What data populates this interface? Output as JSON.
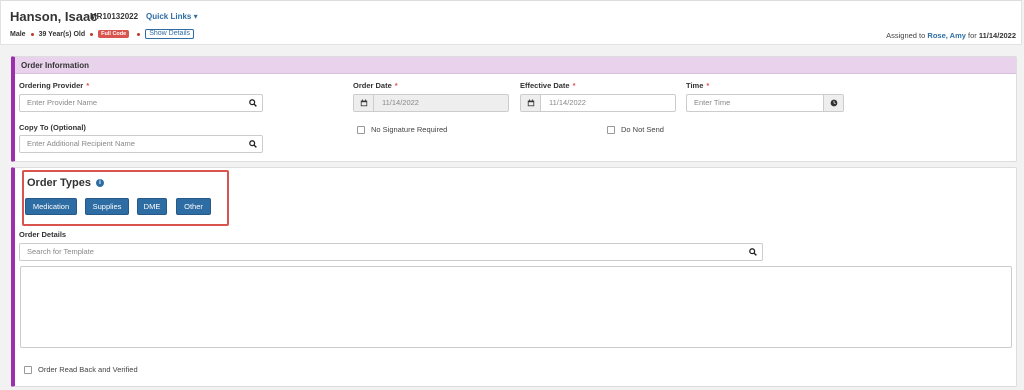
{
  "header": {
    "patient_name": "Hanson, Isaac",
    "mrn": "MR10132022",
    "quick_links": "Quick Links ▾",
    "sex": "Male",
    "age": "39 Year(s) Old",
    "code_badge": "Full Code",
    "show_details": "Show Details",
    "assigned_prefix": "Assigned to",
    "assigned_to": "Rose, Amy",
    "assigned_for": "for",
    "assigned_date": "11/14/2022"
  },
  "order_info": {
    "title": "Order Information",
    "ordering_provider_label": "Ordering Provider",
    "ordering_provider_placeholder": "Enter Provider Name",
    "order_date_label": "Order Date",
    "order_date_value": "11/14/2022",
    "effective_date_label": "Effective Date",
    "effective_date_value": "11/14/2022",
    "time_label": "Time",
    "time_placeholder": "Enter Time",
    "copy_to_label": "Copy To (Optional)",
    "copy_to_placeholder": "Enter Additional Recipient Name",
    "no_signature_label": "No Signature Required",
    "do_not_send_label": "Do Not Send",
    "required_mark": "*"
  },
  "order_types": {
    "title": "Order Types",
    "info_glyph": "i",
    "buttons": [
      "Medication",
      "Supplies",
      "DME",
      "Other"
    ],
    "order_details_label": "Order Details",
    "template_search_placeholder": "Search for Template",
    "read_back_label": "Order Read Back and Verified"
  },
  "colors": {
    "accent_purple": "#9b2fae",
    "primary_blue": "#2e6da4",
    "danger_red": "#d9534f"
  },
  "icons": [
    "search-icon",
    "calendar-icon",
    "clock-icon",
    "info-icon",
    "chevron-down-icon"
  ]
}
